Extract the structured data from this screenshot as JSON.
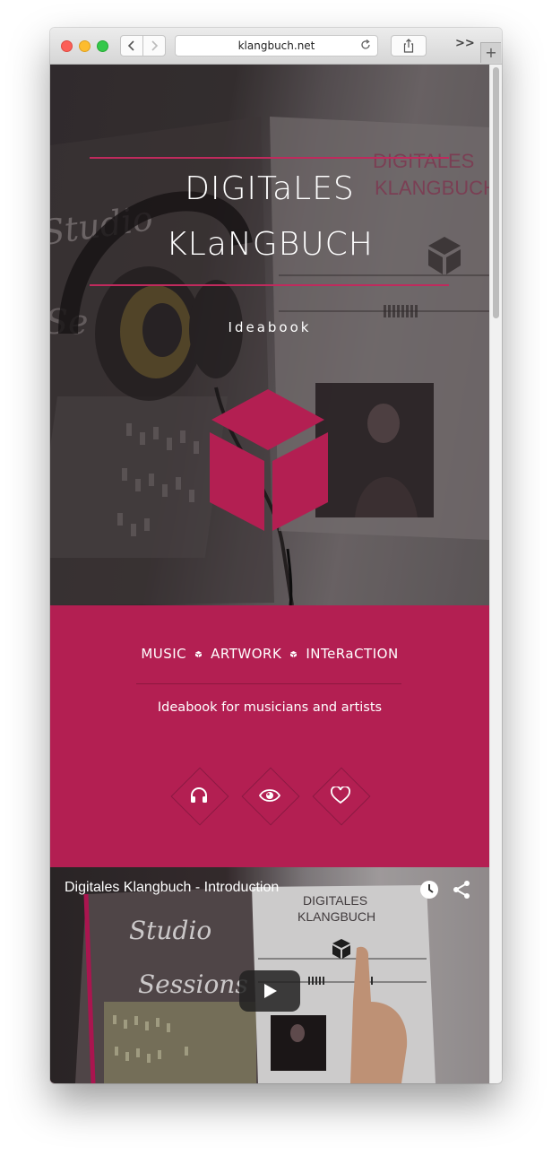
{
  "browser": {
    "url": "klangbuch.net",
    "overflow_label": ">>",
    "newtab_label": "+"
  },
  "hero": {
    "title_line1": "DIGITaLES",
    "title_line2": "KLaNGBUCH",
    "subtitle": "Ideabook",
    "accent": "#b31f52"
  },
  "band": {
    "items": [
      "MUSIC",
      "ARTWORK",
      "INTeRaCTION"
    ],
    "tagline": "Ideabook for musicians and artists",
    "background": "#b31f52",
    "icons": [
      "headphones-icon",
      "eye-icon",
      "heart-icon"
    ]
  },
  "video": {
    "title": "Digitales Klangbuch - Introduction",
    "book_title_line1": "DIGITALES",
    "book_title_line2": "KLANGBUCH",
    "book_cover_text1": "Studio",
    "book_cover_text2": "Sessions"
  },
  "photo_text": {
    "book_title_line1": "DIGITALES",
    "book_title_line2": "KLANGBUCH",
    "script_text1": "Studio",
    "script_text2": "Se"
  }
}
